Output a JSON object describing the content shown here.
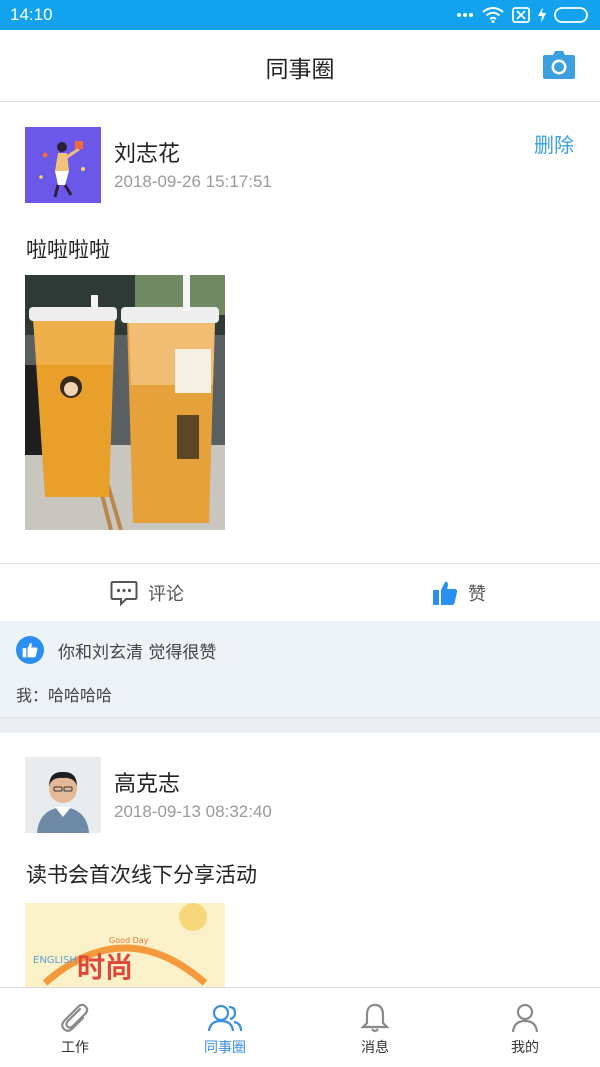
{
  "status_bar": {
    "time": "14:10",
    "battery_icon": "battery-icon",
    "wifi_icon": "wifi-icon"
  },
  "nav": {
    "title": "同事圈",
    "camera_icon": "camera-icon"
  },
  "posts": [
    {
      "author": "刘志花",
      "time": "2018-09-26 15:17:51",
      "delete_label": "删除",
      "text": "啦啦啦啦",
      "actions": {
        "comment_label": "评论",
        "like_label": "赞"
      },
      "likes_text": "你和刘玄清 觉得很赞",
      "comment": "我：哈哈哈哈"
    },
    {
      "author": "高克志",
      "time": "2018-09-13 08:32:40",
      "text": "读书会首次线下分享活动",
      "image_text": "时尚",
      "image_letters": "ENGLISH",
      "image_small": "Good Day"
    }
  ],
  "tabs": [
    {
      "label": "工作",
      "icon": "paperclip-icon",
      "active": false
    },
    {
      "label": "同事圈",
      "icon": "people-icon",
      "active": true
    },
    {
      "label": "消息",
      "icon": "bell-icon",
      "active": false
    },
    {
      "label": "我的",
      "icon": "person-icon",
      "active": false
    }
  ],
  "colors": {
    "status_bar": "#13a3ee",
    "accent": "#3b9fe0",
    "like_blue": "#2a8ff0",
    "panel": "#eef3f7"
  }
}
